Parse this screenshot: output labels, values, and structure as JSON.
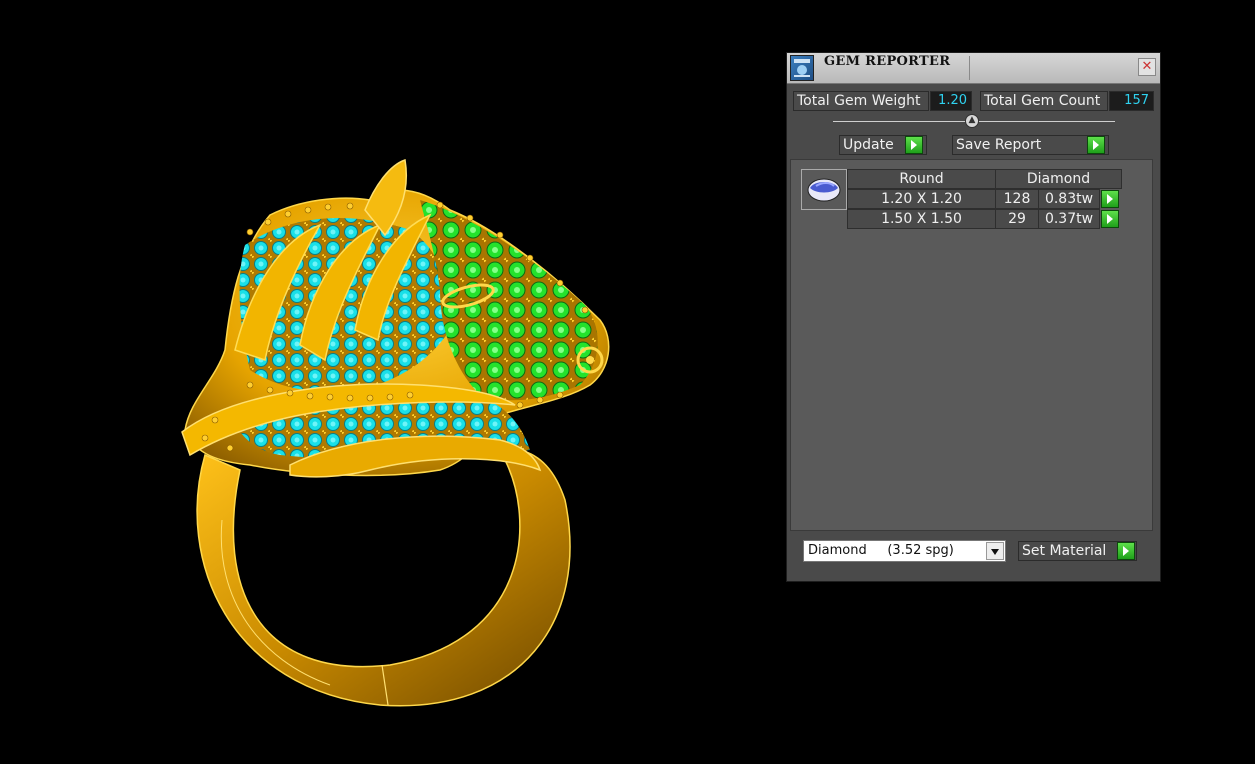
{
  "panel": {
    "title": "GEM REPORTER",
    "close_glyph": "✕",
    "total_weight_label": "Total Gem Weight",
    "total_weight_value": "1.20",
    "total_count_label": "Total Gem Count",
    "total_count_value": "157",
    "update_label": "Update",
    "save_report_label": "Save Report",
    "table": {
      "shape": "Round",
      "material": "Diamond",
      "rows": [
        {
          "size": "1.20 X 1.20",
          "count": "128",
          "weight": "0.83tw"
        },
        {
          "size": "1.50 X 1.50",
          "count": "29",
          "weight": "0.37tw"
        }
      ]
    },
    "material_select": {
      "value": "Diamond     (3.52 spg)"
    },
    "set_material_label": "Set Material"
  },
  "colors": {
    "gold": "#f0b300",
    "gem_cyan": "#19e0e8",
    "gem_green": "#24e22c",
    "value_text": "#2fd2f0"
  },
  "icons": [
    "app-icon",
    "close-icon",
    "slider-knob-icon",
    "play-arrow-icon",
    "round-gem-icon",
    "dropdown-arrow-icon"
  ]
}
